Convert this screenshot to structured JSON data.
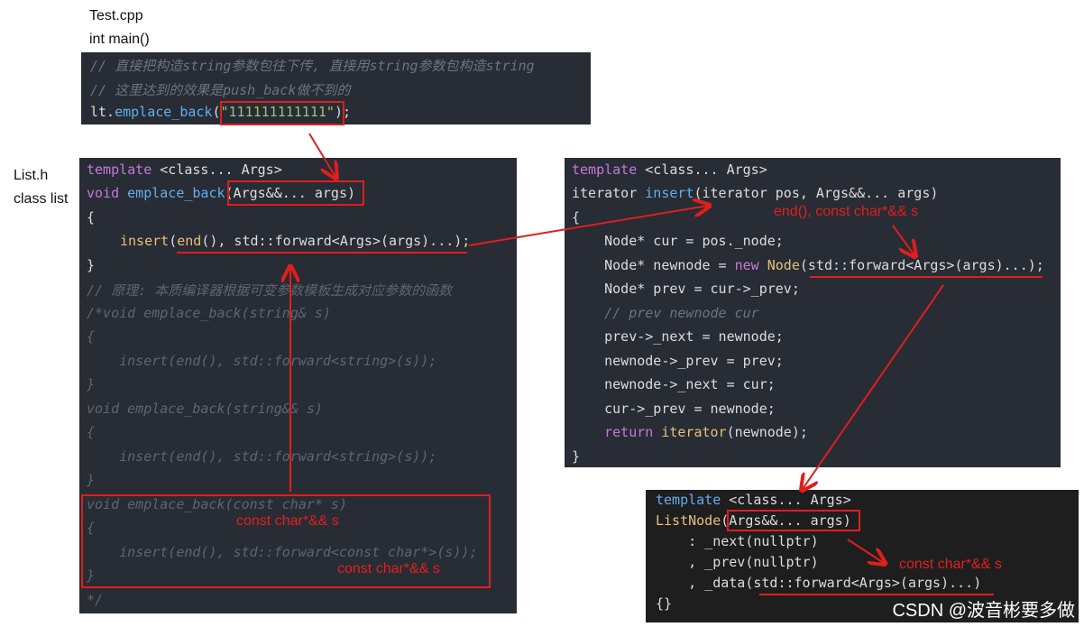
{
  "labels": {
    "test_file": "Test.cpp",
    "test_func": "int main()",
    "list_file": "List.h",
    "list_class": "class list"
  },
  "block_main": {
    "comment1": "// 直接把构造string参数包往下传, 直接用string参数包构造string",
    "comment2": "// 这里达到的效果是push_back做不到的",
    "call_obj": "lt.",
    "call_fn": "emplace_back",
    "call_open": "(",
    "call_arg": "\"111111111111\"",
    "call_close": ");"
  },
  "block_emplace": {
    "l1_kw": "template",
    "l1_rest": " <class... Args>",
    "l2_kw": "void",
    "l2_fn": " emplace_back",
    "l2_params": "(Args&&... args)",
    "l3": "{",
    "l4_fn": "insert",
    "l4_open": "(",
    "l4_end": "end",
    "l4_rest": "(), std::forward<Args>(args)...);",
    "l5": "}",
    "l6": "// 原理: 本质编译器根据可变参数模板生成对应参数的函数",
    "l7": "/*void emplace_back(string& s)",
    "l8": "{",
    "l9": "    insert(end(), std::forward<string>(s));",
    "l10": "}",
    "l11": "void emplace_back(string&& s)",
    "l12": "{",
    "l13": "    insert(end(), std::forward<string>(s));",
    "l14": "}",
    "l15": "void emplace_back(const char* s)",
    "l16": "{",
    "l17": "    insert(end(), std::forward<const char*>(s));",
    "l18": "}",
    "l19": "*/"
  },
  "block_insert": {
    "l1_kw": "template",
    "l1_rest": " <class... Args>",
    "l2_ty": "iterator",
    "l2_fn": " insert",
    "l2_rest": "(iterator pos, Args&&... args)",
    "l3": "{",
    "l4": "    Node* cur = pos._node;",
    "l5_a": "    Node* newnode = ",
    "l5_kw": "new",
    "l5_ty": " Node",
    "l5_rest": "(std::forward<Args>(args)...);",
    "l6": "    Node* prev = cur->_prev;",
    "l7": "    // prev newnode cur",
    "l8": "    prev->_next = newnode;",
    "l9": "    newnode->_prev = prev;",
    "l10": "    newnode->_next = cur;",
    "l11": "    cur->_prev = newnode;",
    "l12_kw": "    return",
    "l12_fn": " iterator",
    "l12_rest": "(newnode);",
    "l13": "}"
  },
  "block_node": {
    "l1_kw": "template",
    "l1_rest": " <class... Args>",
    "l2_fn": "ListNode",
    "l2_params": "(Args&&... args)",
    "l3": "    : _next(nullptr)",
    "l4": "    , _prev(nullptr)",
    "l5": "    , _data(std::forward<Args>(args)...)",
    "l6": "{}"
  },
  "annotations": {
    "a1": "const char*&& s",
    "a2": "const char*&& s",
    "a3": "end(), const char*&& s",
    "a4": "const char*&& s"
  },
  "watermark": "CSDN @波音彬要多做"
}
